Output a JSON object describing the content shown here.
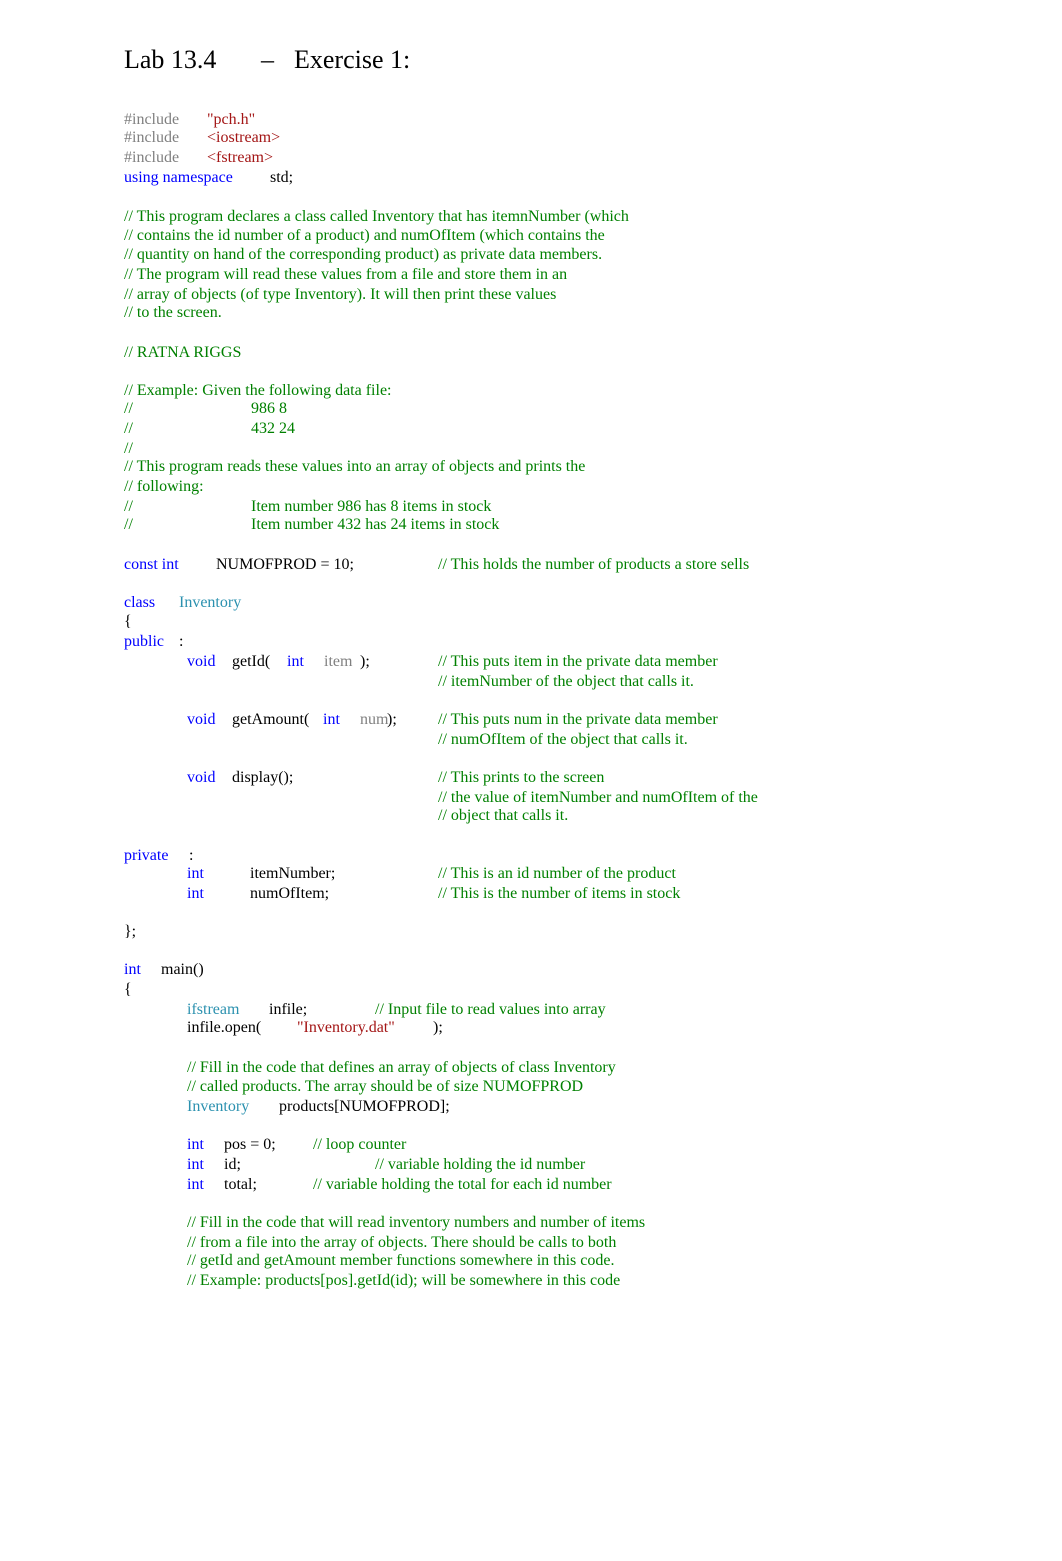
{
  "title": {
    "lab": "Lab 13.4",
    "dash": "–",
    "exercise": "Exercise 1:"
  },
  "includes": [
    {
      "directive": "#include",
      "file": "\"pch.h\""
    },
    {
      "directive": "#include",
      "file": "<iostream>"
    },
    {
      "directive": "#include",
      "file": "<fstream>"
    }
  ],
  "using": {
    "keyword": "using namespace",
    "name": "std;"
  },
  "header_comments": [
    "// This program declares a class called Inventory that has itemnNumber (which",
    "// contains the id number of a product) and numOfItem (which contains the",
    "// quantity on hand of the corresponding product) as private data members.",
    "// The program will read these values from a file and store them in an",
    "// array of objects (of type Inventory). It will then print these values",
    "// to the screen."
  ],
  "author_comment": "// RATNA RIGGS",
  "example": {
    "intro": "// Example: Given the following data file:",
    "slashes": "//",
    "data_lines": [
      "986 8",
      "432 24"
    ],
    "reads_lines": [
      "// This program reads these values into an array of objects and prints the",
      "// following:"
    ],
    "output_lines": [
      "Item number 986 has 8 items in stock",
      "Item number 432 has 24 items in stock"
    ]
  },
  "const_decl": {
    "keyword": "const int",
    "code": "NUMOFPROD = 10;",
    "comment": "// This holds the number of products a store sells"
  },
  "class_decl": {
    "keyword": "class",
    "name": "Inventory",
    "open_brace": "{",
    "public": "public",
    "private": "private",
    "colon": ":",
    "close": "};"
  },
  "methods": [
    {
      "ret": "void",
      "name": "getId(",
      "ptype": "int",
      "pname": "item",
      "end": ");",
      "comments": [
        "// This puts item in the private data member",
        "// itemNumber of the object that calls it."
      ]
    },
    {
      "ret": "void",
      "name": "getAmount(",
      "ptype": "int",
      "pname": "num",
      "end": ");",
      "comments": [
        "// This puts num in the private data member",
        "// numOfItem of the object that calls it."
      ]
    },
    {
      "ret": "void",
      "name": "display();",
      "comments": [
        "// This prints to the screen",
        "// the value of itemNumber and numOfItem of the",
        "// object that calls it."
      ]
    }
  ],
  "members": [
    {
      "type": "int",
      "name": "itemNumber;",
      "comment": "// This is an id number of the product"
    },
    {
      "type": "int",
      "name": "numOfItem;",
      "comment": "// This is the number of items in stock"
    }
  ],
  "main": {
    "ret": "int",
    "name": "main()",
    "open_brace": "{",
    "ifstream": {
      "type": "ifstream",
      "name": "infile;",
      "comment": "// Input file to read values into array"
    },
    "open_call": {
      "call": "infile.open(",
      "arg": "\"Inventory.dat\"",
      "end": ");"
    },
    "array_comments": [
      "// Fill in the code that defines an array of objects of class Inventory",
      "// called products. The array should be of size NUMOFPROD"
    ],
    "array_decl": {
      "type": "Inventory",
      "name": "products[NUMOFPROD];"
    },
    "vars": [
      {
        "type": "int",
        "name": "pos = 0;",
        "comment": "// loop counter"
      },
      {
        "type": "int",
        "name": "id;",
        "comment": "// variable holding the id number"
      },
      {
        "type": "int",
        "name": "total;",
        "comment": "// variable holding the total for each id number"
      }
    ],
    "fill_comments": [
      "// Fill in the code that will read inventory numbers and number of items",
      "// from a file into the array of objects. There should be calls to both",
      "// getId and getAmount member functions somewhere in this code.",
      "// Example: products[pos].getId(id); will be somewhere in this code"
    ]
  }
}
